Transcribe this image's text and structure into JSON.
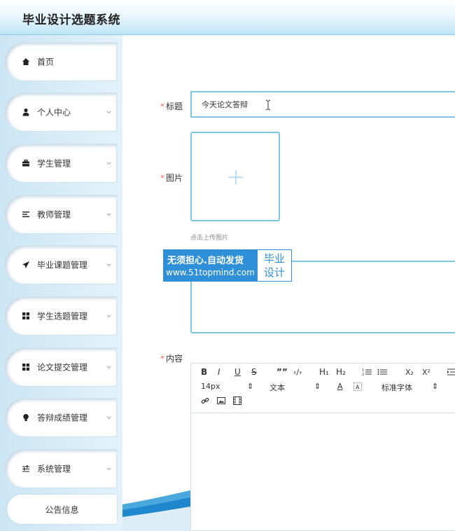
{
  "header": {
    "title": "毕业设计选题系统"
  },
  "sidebar": {
    "items": [
      {
        "label": "首页"
      },
      {
        "label": "个人中心"
      },
      {
        "label": "学生管理"
      },
      {
        "label": "教师管理"
      },
      {
        "label": "毕业课题管理"
      },
      {
        "label": "学生选题管理"
      },
      {
        "label": "论文提交管理"
      },
      {
        "label": "答辩成绩管理"
      },
      {
        "label": "系统管理"
      }
    ],
    "notice": "公告信息"
  },
  "form": {
    "title_label": "标题",
    "title_value": "今天论文答辩",
    "image_label": "图片",
    "upload_tip": "点击上传图片",
    "content_label": "内容",
    "required_mark": "*"
  },
  "watermark": {
    "line1": "无须担心.自动发货",
    "line2": "www.51topmind.com",
    "right1": "毕业",
    "right2": "设计"
  },
  "editor": {
    "row1": {
      "bold": "B",
      "italic": "I",
      "underline": "U",
      "strike": "S",
      "quote": "””",
      "code": "‹/›",
      "h1": "H₁",
      "h2": "H₂",
      "sub": "X₂",
      "sup": "X²"
    },
    "row2": {
      "size": "14px",
      "size_arrow": "⇕",
      "format": "文本",
      "format_arrow": "⇕",
      "font_color": "A",
      "font": "标准字体",
      "font_arrow": "⇕"
    }
  },
  "colors": {
    "accent": "#7fc3e2",
    "required": "#f56c6c",
    "watermark": "#2f8fd8"
  }
}
